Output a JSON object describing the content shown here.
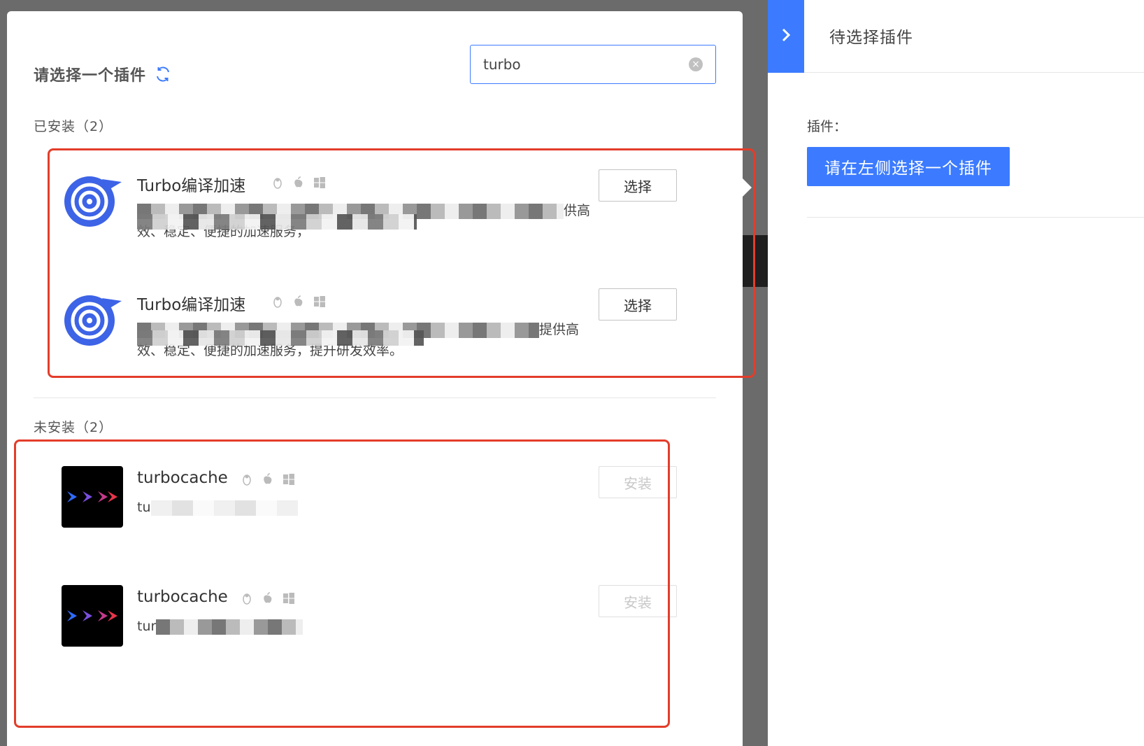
{
  "modal": {
    "title": "请选择一个插件",
    "search": {
      "value": "turbo",
      "clear_label": "×"
    },
    "installed_section": "已安装（2）",
    "uninstalled_section": "未安装（2）",
    "installed": [
      {
        "name": "Turbo编译加速",
        "desc_line1_tail": "供高",
        "desc_line2_head": "效、稳定、便捷的加速服务，",
        "desc_line2_tail": "",
        "select_label": "选择",
        "os_icons": [
          "linux-icon",
          "apple-icon",
          "windows-icon"
        ]
      },
      {
        "name": "Turbo编译加速",
        "desc_line1_tail": "提供高",
        "desc_line2_head": "效、稳定、便捷的加速服务，提升研发效率。",
        "desc_line2_tail": "",
        "select_label": "选择",
        "os_icons": [
          "linux-icon",
          "apple-icon",
          "windows-icon"
        ]
      }
    ],
    "uninstalled": [
      {
        "name": "turbocache",
        "desc_prefix": "tu",
        "install_label": "安装",
        "os_icons": [
          "linux-icon",
          "apple-icon",
          "windows-icon"
        ]
      },
      {
        "name": "turbocache",
        "desc_prefix": "tur",
        "install_label": "安装",
        "os_icons": [
          "linux-icon",
          "apple-icon",
          "windows-icon"
        ]
      }
    ]
  },
  "side_panel": {
    "title": "待选择插件",
    "plugin_label": "插件：",
    "placeholder_button": "请在左侧选择一个插件"
  },
  "colors": {
    "accent": "#3c7bff",
    "annotation_red": "#e33d2a",
    "overlay": "#6b6b6b"
  }
}
